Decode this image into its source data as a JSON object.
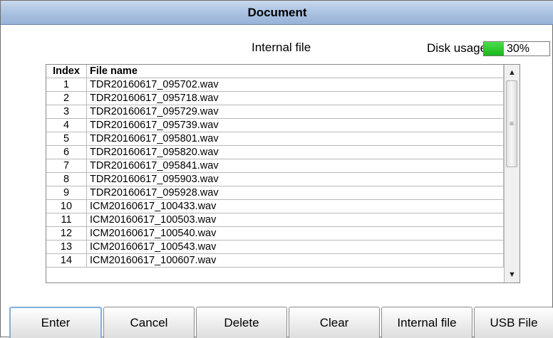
{
  "window": {
    "title": "Document"
  },
  "header": {
    "source_label": "Internal file",
    "disk_usage_label": "Disk usage:",
    "disk_usage_value": "30%",
    "disk_usage_fraction": 0.3,
    "disk_fill_color": "#22c222"
  },
  "table": {
    "columns": {
      "index": "Index",
      "file_name": "File name"
    },
    "rows": [
      {
        "index": "1",
        "name": "TDR20160617_095702.wav"
      },
      {
        "index": "2",
        "name": "TDR20160617_095718.wav"
      },
      {
        "index": "3",
        "name": "TDR20160617_095729.wav"
      },
      {
        "index": "4",
        "name": "TDR20160617_095739.wav"
      },
      {
        "index": "5",
        "name": "TDR20160617_095801.wav"
      },
      {
        "index": "6",
        "name": "TDR20160617_095820.wav"
      },
      {
        "index": "7",
        "name": "TDR20160617_095841.wav"
      },
      {
        "index": "8",
        "name": "TDR20160617_095903.wav"
      },
      {
        "index": "9",
        "name": "TDR20160617_095928.wav"
      },
      {
        "index": "10",
        "name": "ICM20160617_100433.wav"
      },
      {
        "index": "11",
        "name": "ICM20160617_100503.wav"
      },
      {
        "index": "12",
        "name": "ICM20160617_100540.wav"
      },
      {
        "index": "13",
        "name": "ICM20160617_100543.wav"
      },
      {
        "index": "14",
        "name": "ICM20160617_100607.wav"
      }
    ]
  },
  "scrollbar": {
    "up_icon": "triangle-up-icon",
    "down_icon": "triangle-down-icon",
    "grip_icon": "grip-icon"
  },
  "buttons": {
    "enter": "Enter",
    "cancel": "Cancel",
    "delete": "Delete",
    "clear": "Clear",
    "internal_file": "Internal file",
    "usb_file": "USB File"
  }
}
